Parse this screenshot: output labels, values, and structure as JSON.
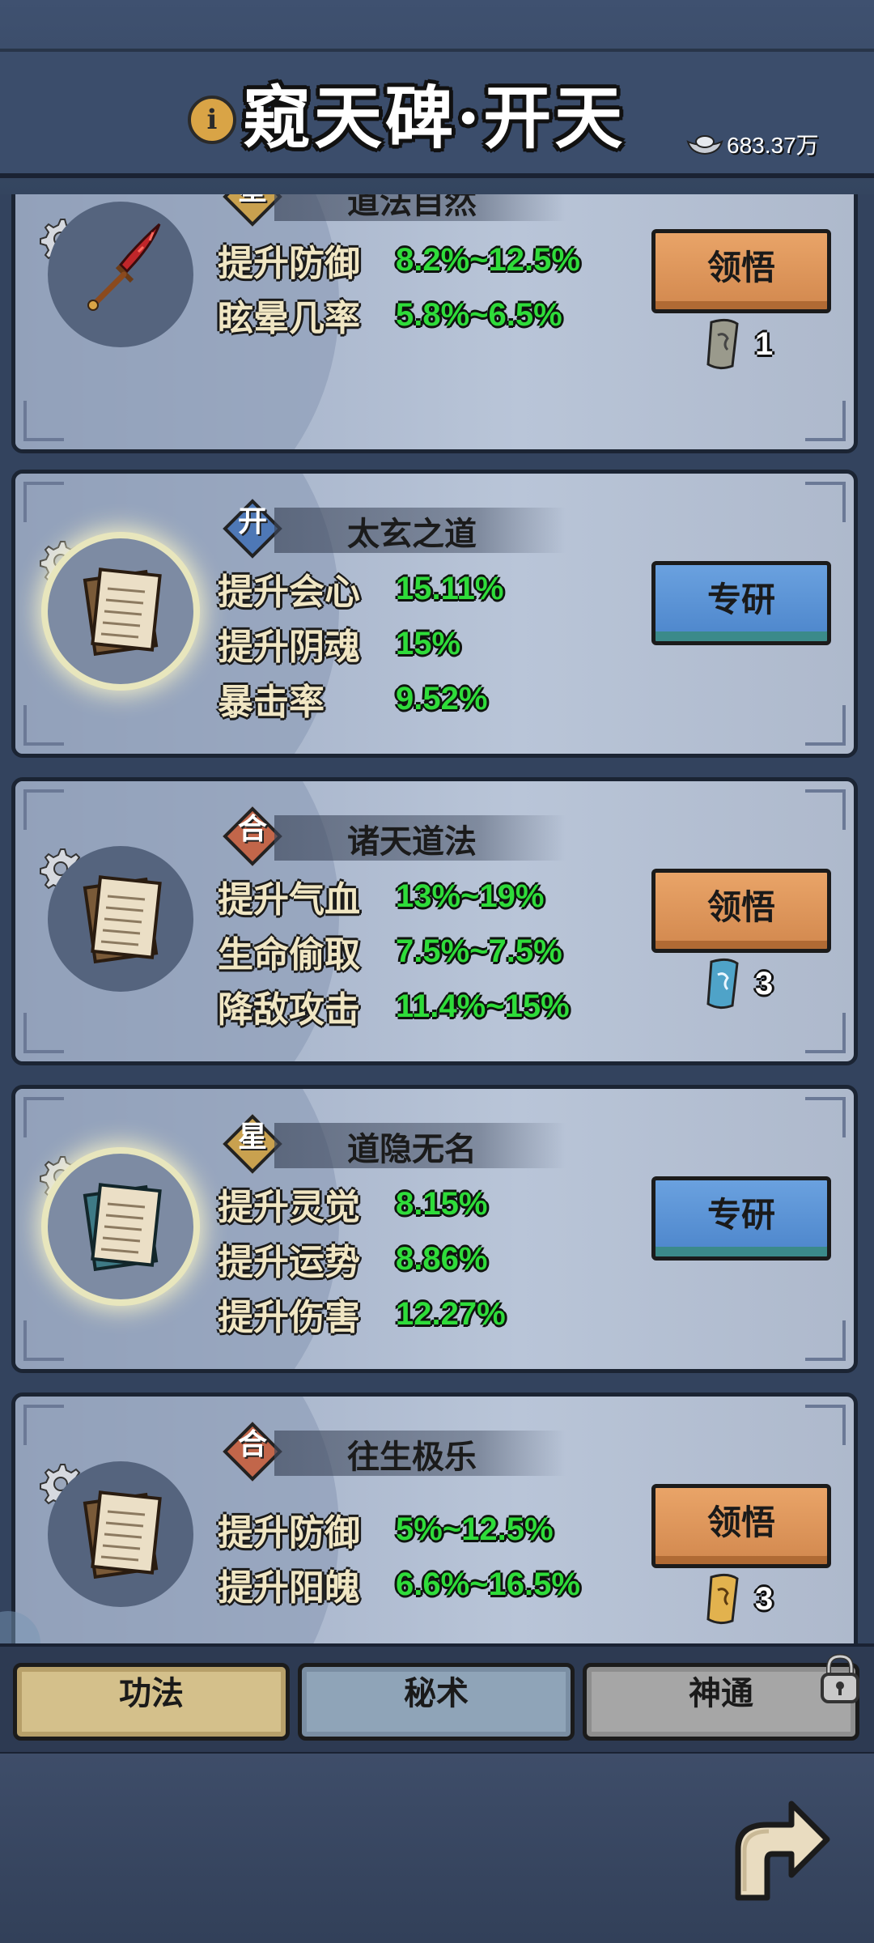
{
  "header": {
    "title": "窥天碑·开天",
    "info_icon": "info-icon",
    "currency": {
      "icon": "silver-ingot-icon",
      "value": "683.37万"
    }
  },
  "cards": [
    {
      "rank": "星",
      "rank_color": "#c9a14f",
      "name": "道法自然",
      "item_icon": "red-sword-icon",
      "stats": [
        {
          "label": "提升防御",
          "value": "8.2%~12.5%"
        },
        {
          "label": "眩晕几率",
          "value": "5.8%~6.5%"
        }
      ],
      "button": {
        "label": "领悟",
        "style": "orange"
      },
      "cost": {
        "icon": "gray-scroll-icon",
        "value": "1"
      }
    },
    {
      "rank": "开",
      "rank_color": "#4e78b6",
      "name": "太玄之道",
      "item_icon": "brown-scroll-icon",
      "stats": [
        {
          "label": "提升会心",
          "value": "15.11%"
        },
        {
          "label": "提升阴魂",
          "value": "15%"
        },
        {
          "label": "暴击率",
          "value": "9.52%"
        }
      ],
      "button": {
        "label": "专研",
        "style": "blue"
      }
    },
    {
      "rank": "合",
      "rank_color": "#c2664a",
      "name": "诸天道法",
      "item_icon": "brown-scroll-icon",
      "stats": [
        {
          "label": "提升气血",
          "value": "13%~19%"
        },
        {
          "label": "生命偷取",
          "value": "7.5%~7.5%"
        },
        {
          "label": "降敌攻击",
          "value": "11.4%~15%"
        }
      ],
      "button": {
        "label": "领悟",
        "style": "orange"
      },
      "cost": {
        "icon": "blue-scroll-icon",
        "value": "3"
      }
    },
    {
      "rank": "星",
      "rank_color": "#c9a14f",
      "name": "道隐无名",
      "item_icon": "teal-scroll-icon",
      "stats": [
        {
          "label": "提升灵觉",
          "value": "8.15%"
        },
        {
          "label": "提升运势",
          "value": "8.86%"
        },
        {
          "label": "提升伤害",
          "value": "12.27%"
        }
      ],
      "button": {
        "label": "专研",
        "style": "blue"
      }
    },
    {
      "rank": "合",
      "rank_color": "#c2664a",
      "name": "往生极乐",
      "item_icon": "brown-scroll-icon",
      "stats": [
        {
          "label": "提升防御",
          "value": "5%~12.5%"
        },
        {
          "label": "提升阳魄",
          "value": "6.6%~16.5%"
        }
      ],
      "button": {
        "label": "领悟",
        "style": "orange"
      },
      "cost": {
        "icon": "gold-scroll-icon",
        "value": "3"
      }
    }
  ],
  "tabs": [
    {
      "label": "功法",
      "active": true
    },
    {
      "label": "秘术",
      "active": false
    },
    {
      "label": "神通",
      "active": false,
      "locked": true
    }
  ]
}
